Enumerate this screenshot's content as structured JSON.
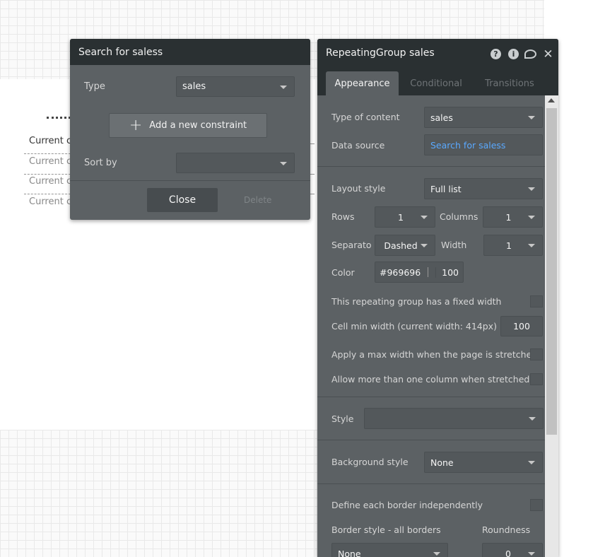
{
  "canvas": {
    "rows": [
      "Current c",
      "Current c",
      "Current c",
      "Current c"
    ]
  },
  "search_popup": {
    "title": "Search for saless",
    "type_label": "Type",
    "type_value": "sales",
    "add_constraint_label": "Add a new constraint",
    "sort_by_label": "Sort by",
    "sort_by_value": "",
    "close_label": "Close",
    "delete_label": "Delete"
  },
  "editor": {
    "title": "RepeatingGroup sales",
    "tabs": [
      "Appearance",
      "Conditional",
      "Transitions"
    ],
    "type_of_content_label": "Type of content",
    "type_of_content_value": "sales",
    "data_source_label": "Data source",
    "data_source_value": "Search for saless",
    "layout_style_label": "Layout style",
    "layout_style_value": "Full list",
    "rows_label": "Rows",
    "rows_value": "1",
    "columns_label": "Columns",
    "columns_value": "1",
    "separator_label": "Separato",
    "separator_value": "Dashed",
    "width_label": "Width",
    "width_value": "1",
    "color_label": "Color",
    "color_hex": "#969696",
    "color_opacity": "100",
    "fixed_width_label": "This repeating group has a fixed width",
    "cell_min_width_label": "Cell min width (current width: 414px)",
    "cell_min_width_value": "100",
    "max_width_label": "Apply a max width when the page is stretched",
    "more_columns_label": "Allow more than one column when stretched",
    "style_label": "Style",
    "style_value": "",
    "background_style_label": "Background style",
    "background_style_value": "None",
    "border_independent_label": "Define each border independently",
    "border_style_label": "Border style - all borders",
    "roundness_label": "Roundness",
    "border_style_value": "None",
    "roundness_value": "0"
  },
  "colors": {
    "panel": "#5c6164",
    "header": "#2a3032",
    "link": "#5aa9ff",
    "separator_swatch": "#969696"
  }
}
